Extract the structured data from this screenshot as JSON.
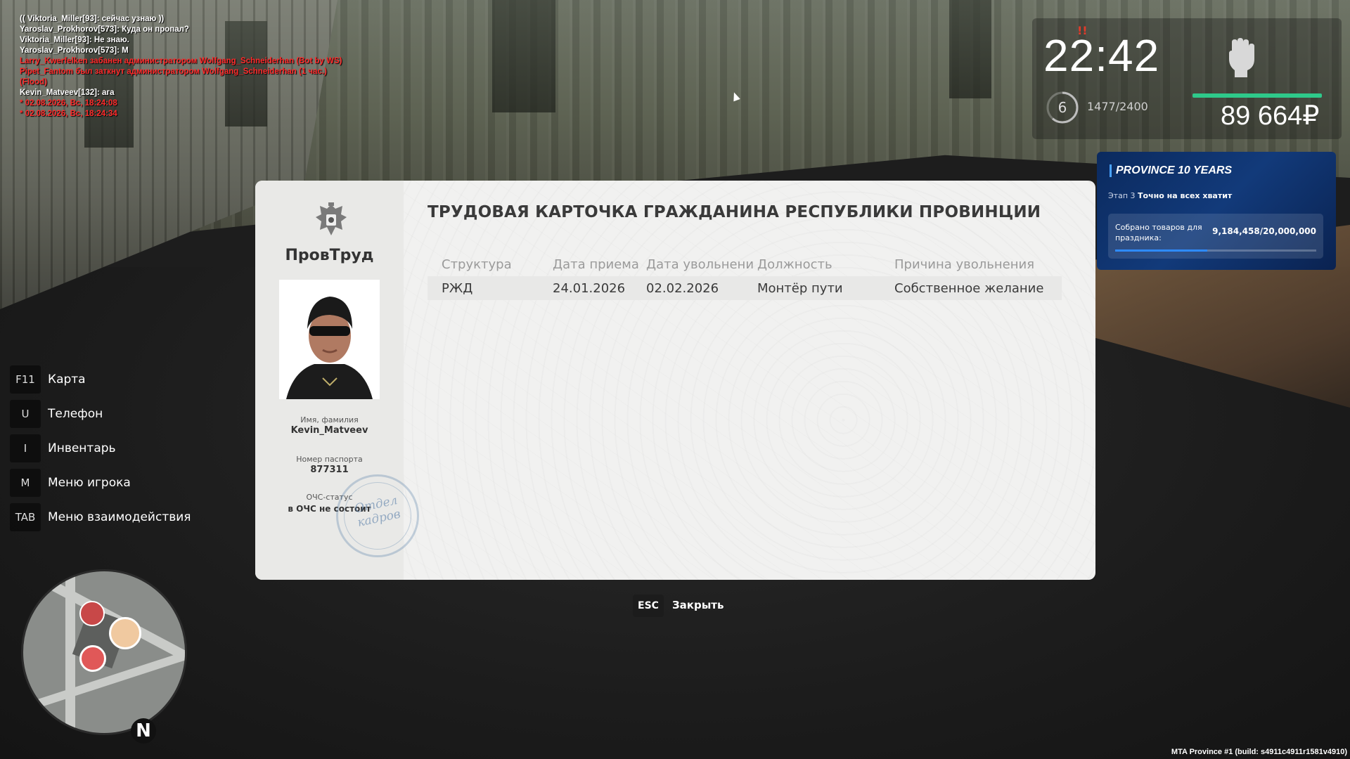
{
  "chat": [
    {
      "text": "(( Viktoria_Miller[93]: сейчас узнаю ))",
      "color": "white"
    },
    {
      "text": "Yaroslav_Prokhorov[573]: Куда он пропал?",
      "color": "white"
    },
    {
      "text": "Viktoria_Miller[93]: Не знаю.",
      "color": "white"
    },
    {
      "text": "Yaroslav_Prokhorov[573]: М",
      "color": "white"
    },
    {
      "text": "Larry_Kwerfelken забанен администратором Wolfgang_Schneiderhan (Bot by WS)",
      "color": "red"
    },
    {
      "text": "Pipet_Fantom был заткнут администратором Wolfgang_Schneiderhan (1 час.)",
      "color": "red"
    },
    {
      "text": "(Flood)",
      "color": "red"
    },
    {
      "text": "Kevin_Matveev[132]: ага",
      "color": "white"
    },
    {
      "text": "* 02.08.2026, Вс, 18:24:08",
      "color": "red"
    },
    {
      "text": "* 02.08.2026, Вс, 18:24:34",
      "color": "red"
    }
  ],
  "hud": {
    "time": "22:42",
    "alert_mark": "!!",
    "level": "6",
    "xp": "1477/2400",
    "xp_fraction": 0.615,
    "money": "89 664₽",
    "health_fraction": 1.0,
    "fist_icon": "fist-icon"
  },
  "event": {
    "title": "PROVINCE 10 YEARS",
    "stage_prefix": "Этап 3",
    "stage_name": "Точно на всех хватит",
    "collected_label": "Собрано товаров для праздника:",
    "collected_value": "9,184,458/20,000,000",
    "progress_fraction": 0.459
  },
  "hotkeys": [
    {
      "key": "F11",
      "label": "Карта"
    },
    {
      "key": "U",
      "label": "Телефон"
    },
    {
      "key": "I",
      "label": "Инвентарь"
    },
    {
      "key": "M",
      "label": "Меню игрока"
    },
    {
      "key": "TAB",
      "label": "Меню взаимодействия"
    }
  ],
  "minimap": {
    "north": "N"
  },
  "card": {
    "org_name": "ПровТруд",
    "title": "ТРУДОВАЯ КАРТОЧКА ГРАЖДАНИНА РЕСПУБЛИКИ ПРОВИНЦИИ",
    "name_label": "Имя, фамилия",
    "name_value": "Kevin_Matveev",
    "passport_label": "Номер паспорта",
    "passport_value": "877311",
    "status_label": "ОЧС-статус",
    "status_value": "в ОЧС не состоит",
    "stamp_text": "Отдел кадров",
    "columns": [
      "Структура",
      "Дата приема",
      "Дата увольнени",
      "Должность",
      "Причина увольнения"
    ],
    "rows": [
      [
        "РЖД",
        "24.01.2026",
        "02.02.2026",
        "Монтёр пути",
        "Собственное желание"
      ]
    ]
  },
  "close": {
    "key": "ESC",
    "label": "Закрыть"
  },
  "build": "MTA Province #1 (build: s4911c4911r1581v4910)"
}
